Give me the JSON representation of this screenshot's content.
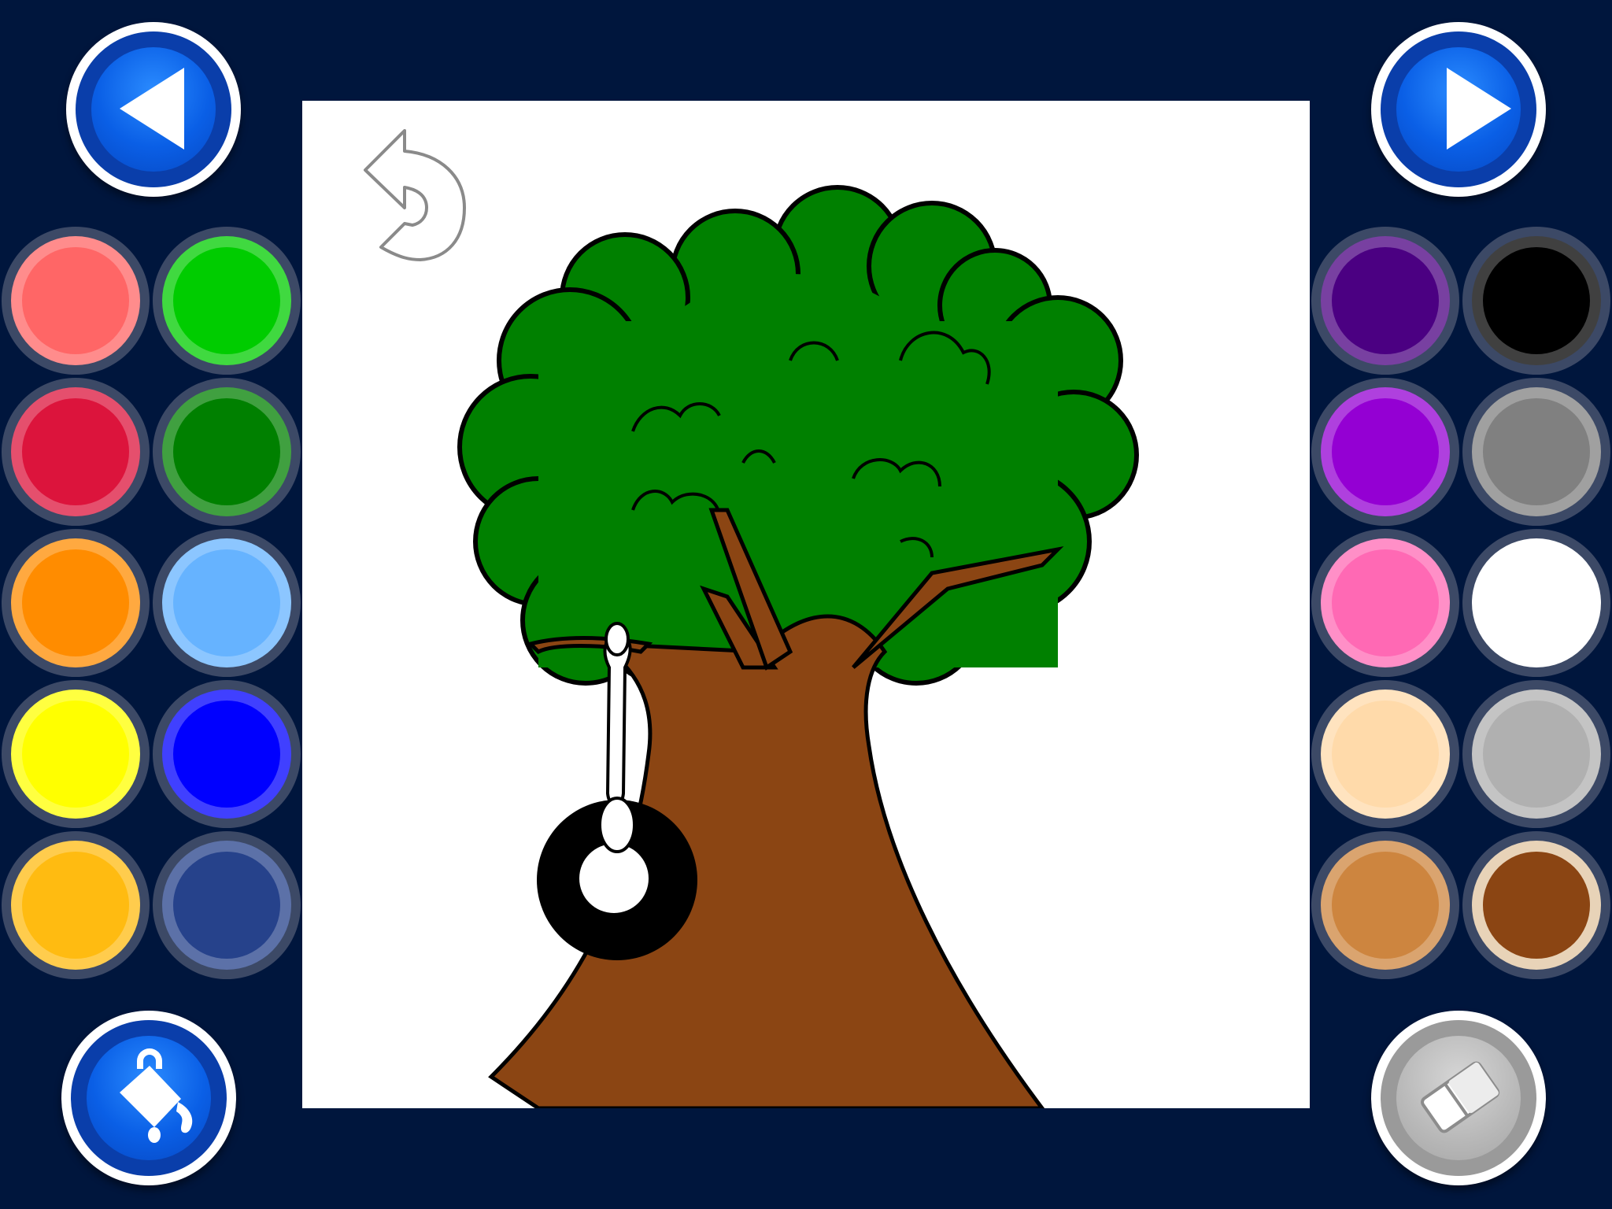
{
  "nav": {
    "back_icon": "triangle-left-icon",
    "next_icon": "triangle-right-icon"
  },
  "tools": {
    "fill_icon": "paint-bucket-icon",
    "eraser_icon": "eraser-icon",
    "undo_icon": "undo-arrow-icon",
    "selected_color": "#8b4513"
  },
  "palette": {
    "left": [
      [
        "#ff6666",
        "#00cc00"
      ],
      [
        "#dc143c",
        "#008000"
      ],
      [
        "#ff8c00",
        "#66b3ff"
      ],
      [
        "#ffff00",
        "#0000ff"
      ],
      [
        "#ffbb11",
        "#26428b"
      ]
    ],
    "right": [
      [
        "#4b0082",
        "#000000"
      ],
      [
        "#9400d3",
        "#808080"
      ],
      [
        "#ff69b4",
        "#ffffff"
      ],
      [
        "#ffdaaa",
        "#b0b0b0"
      ],
      [
        "#cd853f",
        "#8b4513"
      ]
    ]
  },
  "picture": {
    "subject": "tree-with-tire-swing",
    "colors": {
      "leaves": "#008000",
      "trunk": "#8b4513",
      "tire": "#000000",
      "rope": "#ffffff"
    }
  }
}
